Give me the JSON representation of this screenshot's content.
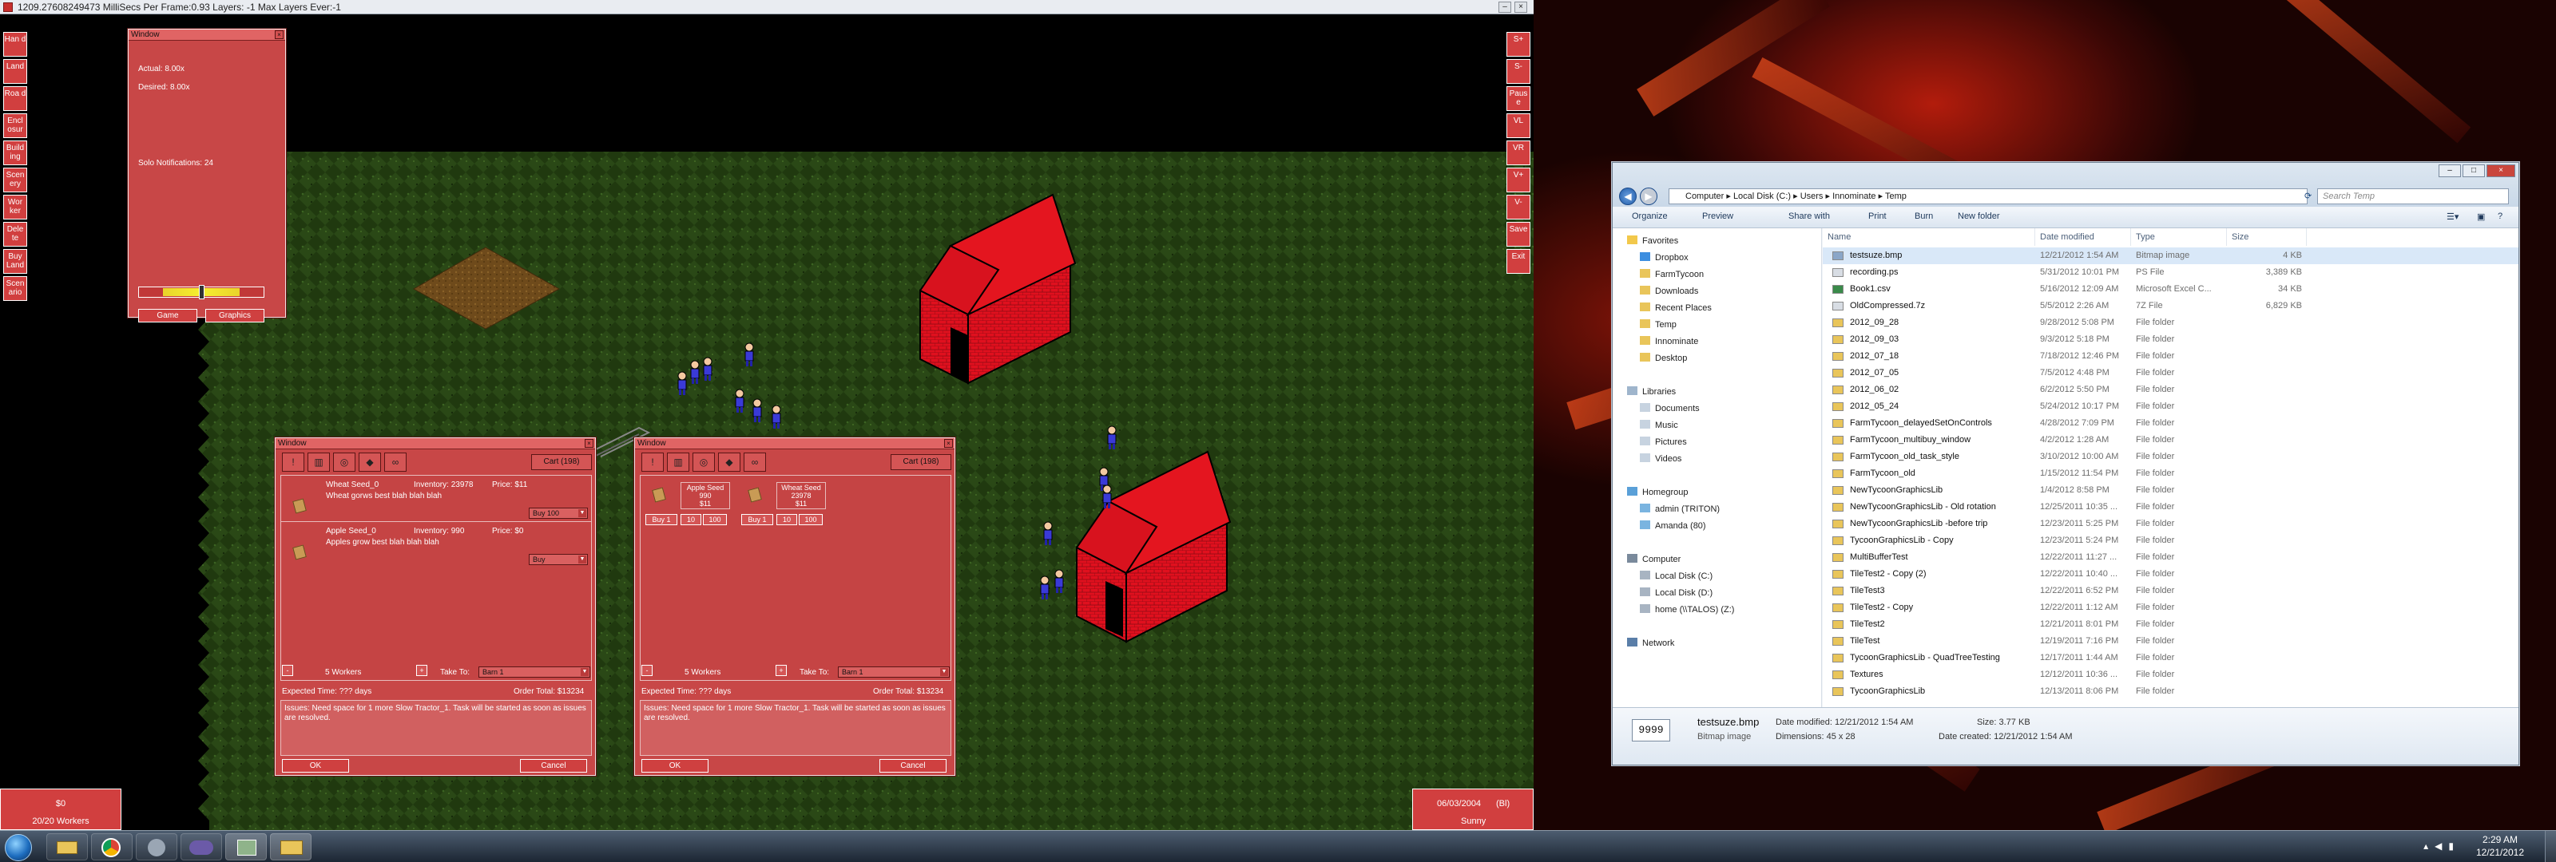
{
  "game": {
    "title": "1209.27608249473   MilliSecs Per Frame:0.93   Layers: -1    Max Layers Ever:-1",
    "left_buttons": [
      "Han d",
      "Land",
      "Roa d",
      "Encl osur",
      "Build ing",
      "Scen ery",
      "Wor ker",
      "Dele te",
      "Buy Land",
      "Scen ario"
    ],
    "right_buttons": [
      "S+",
      "S-",
      "Paus e",
      "VL",
      "VR",
      "V+",
      "V-",
      "Save",
      "Exit"
    ],
    "stats_window": {
      "title": "Window",
      "actual": "Actual: 8.00x",
      "desired": "Desired: 8.00x",
      "solo": "Solo Notifications: 24",
      "slider_value": 0.52,
      "game_button": "Game",
      "graphics_button": "Graphics"
    },
    "money_panel": {
      "money": "$0",
      "workers": "20/20 Workers"
    },
    "date_panel": {
      "date": "06/03/2004",
      "season": "(Bl)",
      "weather": "Sunny"
    },
    "order_window_1": {
      "title": "Window",
      "cart": "Cart (198)",
      "items": [
        {
          "name": "Wheat Seed_0",
          "inventory": "Inventory: 23978",
          "price": "Price: $11",
          "desc": "Wheat gorws best blah blah blah",
          "buy": "Buy 100"
        },
        {
          "name": "Apple Seed_0",
          "inventory": "Inventory: 990",
          "price": "Price: $0",
          "desc": "Apples grow best blah blah blah",
          "buy": "Buy"
        }
      ],
      "workers": "5 Workers",
      "minus": "-",
      "plus": "+",
      "take_to_label": "Take To:",
      "take_to_value": "Barn 1",
      "expected_time": "Expected Time: ??? days",
      "order_total": "Order Total: $13234",
      "issues": "Issues: Need space for 1 more Slow Tractor_1. Task will be started as soon as issues are resolved.",
      "ok": "OK",
      "cancel": "Cancel"
    },
    "order_window_2": {
      "title": "Window",
      "cart": "Cart (198)",
      "cards": [
        {
          "name": "Apple Seed",
          "qty": "990",
          "price": "$11",
          "b1": "Buy 1",
          "b2": "10",
          "b3": "100"
        },
        {
          "name": "Wheat Seed",
          "qty": "23978",
          "price": "$11",
          "b1": "Buy 1",
          "b2": "10",
          "b3": "100"
        }
      ],
      "workers": "5 Workers",
      "minus": "-",
      "plus": "+",
      "take_to_label": "Take To:",
      "take_to_value": "Barn 1",
      "expected_time": "Expected Time: ??? days",
      "order_total": "Order Total: $13234",
      "issues": "Issues: Need space for 1 more Slow Tractor_1. Task will be started as soon as issues are resolved.",
      "ok": "OK",
      "cancel": "Cancel"
    },
    "tool_icons": [
      "!",
      "seed-bag-icon",
      "barrel-icon",
      "pig-icon",
      "glasses-icon"
    ]
  },
  "explorer": {
    "breadcrumb": [
      "Computer",
      "Local Disk (C:)",
      "Users",
      "Innominate",
      "Temp"
    ],
    "search_placeholder": "Search Temp",
    "toolbar": [
      "Organize",
      "Preview",
      "Share with",
      "Print",
      "Burn",
      "New folder"
    ],
    "nav": {
      "favorites_label": "Favorites",
      "favorites": [
        "Dropbox",
        "FarmTycoon",
        "Downloads",
        "Recent Places",
        "Temp",
        "Innominate",
        "Desktop"
      ],
      "libraries_label": "Libraries",
      "libraries": [
        "Documents",
        "Music",
        "Pictures",
        "Videos"
      ],
      "homegroup_label": "Homegroup",
      "homegroup": [
        "admin (TRITON)",
        "Amanda (80)"
      ],
      "computer_label": "Computer",
      "computer": [
        "Local Disk (C:)",
        "Local Disk (D:)",
        "home (\\\\TALOS) (Z:)"
      ],
      "network_label": "Network"
    },
    "columns": [
      "Name",
      "Date modified",
      "Type",
      "Size"
    ],
    "files": [
      {
        "name": "testsuze.bmp",
        "date": "12/21/2012 1:54 AM",
        "type": "Bitmap image",
        "size": "4 KB",
        "kind": "bmp"
      },
      {
        "name": "recording.ps",
        "date": "5/31/2012 10:01 PM",
        "type": "PS File",
        "size": "3,389 KB",
        "kind": "file"
      },
      {
        "name": "Book1.csv",
        "date": "5/16/2012 12:09 AM",
        "type": "Microsoft Excel C...",
        "size": "34 KB",
        "kind": "csv"
      },
      {
        "name": "OldCompressed.7z",
        "date": "5/5/2012 2:26 AM",
        "type": "7Z File",
        "size": "6,829 KB",
        "kind": "file"
      },
      {
        "name": "2012_09_28",
        "date": "9/28/2012 5:08 PM",
        "type": "File folder",
        "size": "",
        "kind": "folder"
      },
      {
        "name": "2012_09_03",
        "date": "9/3/2012 5:18 PM",
        "type": "File folder",
        "size": "",
        "kind": "folder"
      },
      {
        "name": "2012_07_18",
        "date": "7/18/2012 12:46 PM",
        "type": "File folder",
        "size": "",
        "kind": "folder"
      },
      {
        "name": "2012_07_05",
        "date": "7/5/2012 4:48 PM",
        "type": "File folder",
        "size": "",
        "kind": "folder"
      },
      {
        "name": "2012_06_02",
        "date": "6/2/2012 5:50 PM",
        "type": "File folder",
        "size": "",
        "kind": "folder"
      },
      {
        "name": "2012_05_24",
        "date": "5/24/2012 10:17 PM",
        "type": "File folder",
        "size": "",
        "kind": "folder"
      },
      {
        "name": "FarmTycoon_delayedSetOnControls",
        "date": "4/28/2012 7:09 PM",
        "type": "File folder",
        "size": "",
        "kind": "folder"
      },
      {
        "name": "FarmTycoon_multibuy_window",
        "date": "4/2/2012 1:28 AM",
        "type": "File folder",
        "size": "",
        "kind": "folder"
      },
      {
        "name": "FarmTycoon_old_task_style",
        "date": "3/10/2012 10:00 AM",
        "type": "File folder",
        "size": "",
        "kind": "folder"
      },
      {
        "name": "FarmTycoon_old",
        "date": "1/15/2012 11:54 PM",
        "type": "File folder",
        "size": "",
        "kind": "folder"
      },
      {
        "name": "NewTycoonGraphicsLib",
        "date": "1/4/2012 8:58 PM",
        "type": "File folder",
        "size": "",
        "kind": "folder"
      },
      {
        "name": "NewTycoonGraphicsLib - Old rotation",
        "date": "12/25/2011 10:35 ...",
        "type": "File folder",
        "size": "",
        "kind": "folder"
      },
      {
        "name": "NewTycoonGraphicsLib -before trip",
        "date": "12/23/2011 5:25 PM",
        "type": "File folder",
        "size": "",
        "kind": "folder"
      },
      {
        "name": "TycoonGraphicsLib - Copy",
        "date": "12/23/2011 5:24 PM",
        "type": "File folder",
        "size": "",
        "kind": "folder"
      },
      {
        "name": "MultiBufferTest",
        "date": "12/22/2011 11:27 ...",
        "type": "File folder",
        "size": "",
        "kind": "folder"
      },
      {
        "name": "TileTest2 - Copy (2)",
        "date": "12/22/2011 10:40 ...",
        "type": "File folder",
        "size": "",
        "kind": "folder"
      },
      {
        "name": "TileTest3",
        "date": "12/22/2011 6:52 PM",
        "type": "File folder",
        "size": "",
        "kind": "folder"
      },
      {
        "name": "TileTest2 - Copy",
        "date": "12/22/2011 1:12 AM",
        "type": "File folder",
        "size": "",
        "kind": "folder"
      },
      {
        "name": "TileTest2",
        "date": "12/21/2011 8:01 PM",
        "type": "File folder",
        "size": "",
        "kind": "folder"
      },
      {
        "name": "TileTest",
        "date": "12/19/2011 7:16 PM",
        "type": "File folder",
        "size": "",
        "kind": "folder"
      },
      {
        "name": "TycoonGraphicsLib - QuadTreeTesting",
        "date": "12/17/2011 1:44 AM",
        "type": "File folder",
        "size": "",
        "kind": "folder"
      },
      {
        "name": "Textures",
        "date": "12/12/2011 10:36 ...",
        "type": "File folder",
        "size": "",
        "kind": "folder"
      },
      {
        "name": "TycoonGraphicsLib",
        "date": "12/13/2011 8:06 PM",
        "type": "File folder",
        "size": "",
        "kind": "folder"
      }
    ],
    "details": {
      "thumb": "9999",
      "name": "testsuze.bmp",
      "type": "Bitmap image",
      "modified": "Date modified: 12/21/2012 1:54 AM",
      "dimensions": "Dimensions: 45 x 28",
      "size": "Size: 3.77 KB",
      "created": "Date created: 12/21/2012 1:54 AM"
    }
  },
  "taskbar": {
    "time": "2:29 AM",
    "date": "12/21/2012"
  },
  "colors": {
    "game_red": "#c84747",
    "grass": "#1f3a12",
    "explorer_bg": "#f1f4f8"
  }
}
